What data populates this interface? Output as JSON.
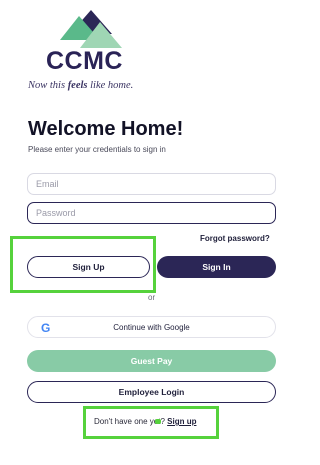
{
  "brand": {
    "logo_text": "CCMC",
    "tagline_before": "Now this ",
    "tagline_bold": "feels",
    "tagline_after": " like home.",
    "colors": {
      "primary": "#2b2656",
      "accent_green": "#88cba6",
      "logo_green": "#5ab98a"
    }
  },
  "form": {
    "title": "Welcome Home!",
    "subtitle": "Please enter your credentials to sign in",
    "email_placeholder": "Email",
    "password_placeholder": "Password",
    "forgot_label": "Forgot password?"
  },
  "buttons": {
    "sign_up": "Sign Up",
    "sign_in": "Sign In",
    "or": "or",
    "google": "Continue with Google",
    "google_icon": "G",
    "guest_pay": "Guest Pay",
    "employee_login": "Employee Login"
  },
  "footer": {
    "prompt": "Don't have one yet? ",
    "link": "Sign up"
  },
  "annotations": {
    "highlight_color": "#56d23c"
  }
}
